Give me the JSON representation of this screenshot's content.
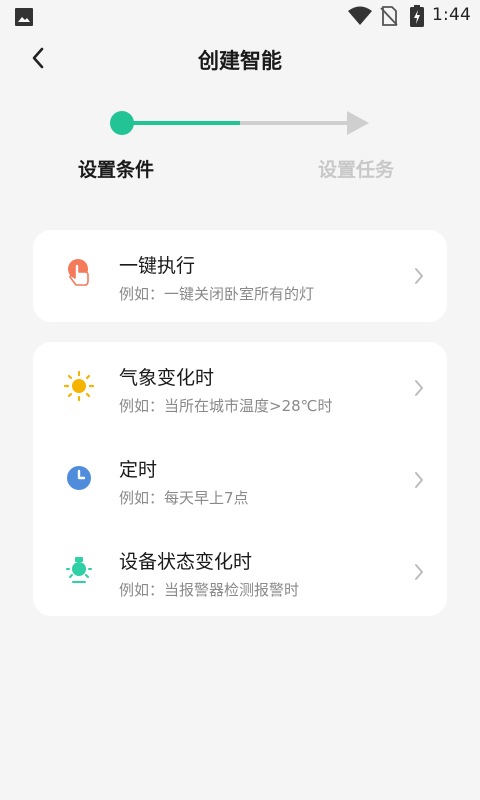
{
  "status_bar": {
    "time": "1:44",
    "icons": [
      "gallery-icon",
      "wifi-icon",
      "no-sim-icon",
      "battery-charging-icon"
    ]
  },
  "header": {
    "title": "创建智能",
    "back_icon": "chevron-left-icon"
  },
  "stepper": {
    "steps": [
      {
        "label": "设置条件",
        "state": "active"
      },
      {
        "label": "设置任务",
        "state": "inactive"
      }
    ],
    "active_color": "#22c496",
    "inactive_color": "#cfcfcf"
  },
  "groups": [
    {
      "items": [
        {
          "icon": "tap-hand-icon",
          "title": "一键执行",
          "desc": "例如：一键关闭卧室所有的灯",
          "icon_color": "#f47a5a"
        }
      ]
    },
    {
      "items": [
        {
          "icon": "sun-icon",
          "title": "气象变化时",
          "desc": "例如：当所在城市温度>28℃时",
          "icon_color": "#f5b400"
        },
        {
          "icon": "clock-icon",
          "title": "定时",
          "desc": "例如：每天早上7点",
          "icon_color": "#4f8ddc"
        },
        {
          "icon": "device-bulb-icon",
          "title": "设备状态变化时",
          "desc": "例如：当报警器检测报警时",
          "icon_color": "#2fd0a6"
        }
      ]
    }
  ]
}
